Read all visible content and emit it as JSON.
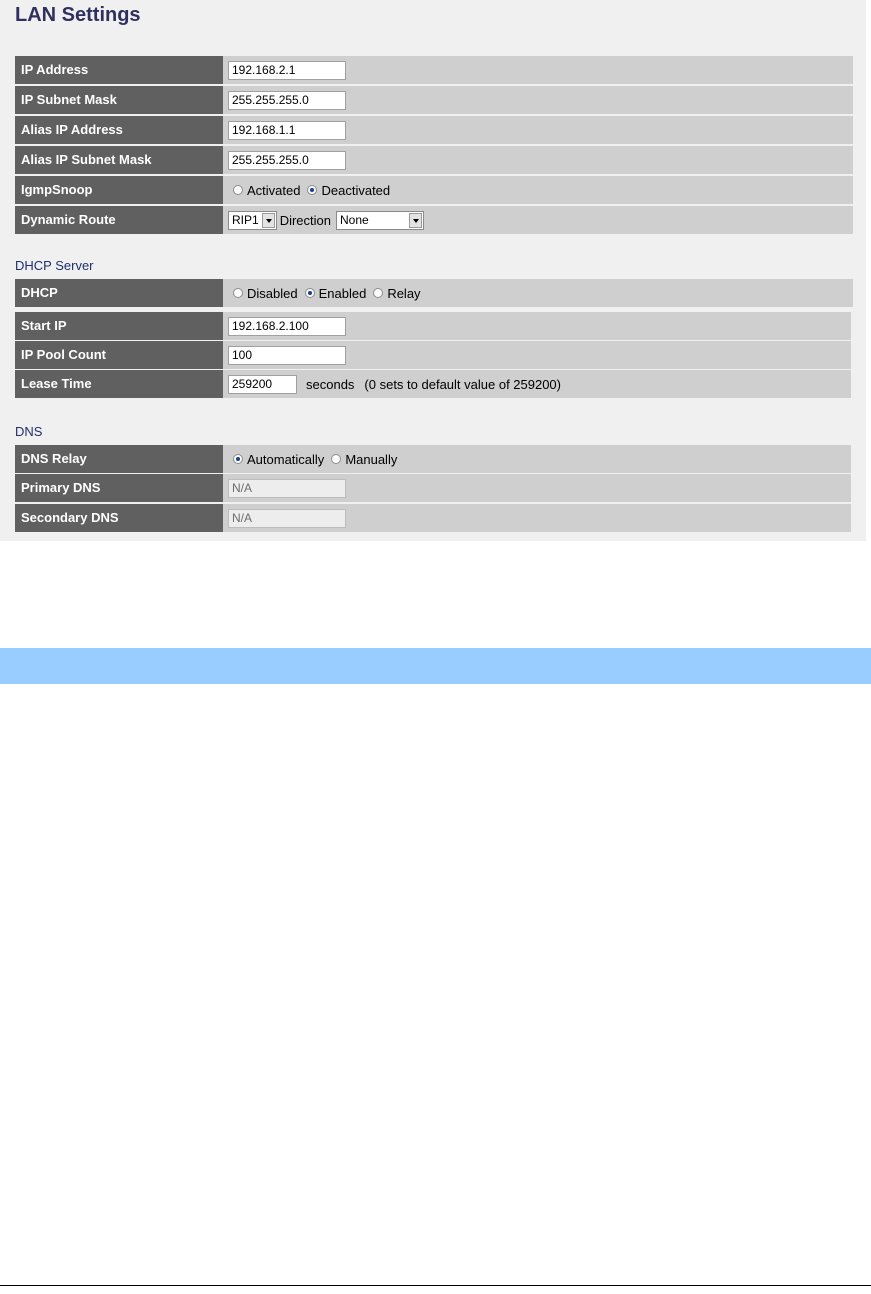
{
  "page_title": "LAN Settings",
  "lan": {
    "ip_address": {
      "label": "IP Address",
      "value": "192.168.2.1"
    },
    "subnet_mask": {
      "label": "IP Subnet Mask",
      "value": "255.255.255.0"
    },
    "alias_ip": {
      "label": "Alias IP Address",
      "value": "192.168.1.1"
    },
    "alias_mask": {
      "label": "Alias IP Subnet Mask",
      "value": "255.255.255.0"
    },
    "igmp": {
      "label": "IgmpSnoop",
      "options": [
        "Activated",
        "Deactivated"
      ],
      "selected": "Deactivated"
    },
    "dynamic_route": {
      "label": "Dynamic Route",
      "rip": "RIP1",
      "direction_label": "Direction",
      "direction": "None"
    }
  },
  "dhcp_section_title": "DHCP Server",
  "dhcp": {
    "mode": {
      "label": "DHCP",
      "options": [
        "Disabled",
        "Enabled",
        "Relay"
      ],
      "selected": "Enabled"
    },
    "start_ip": {
      "label": "Start IP",
      "value": "192.168.2.100"
    },
    "pool_count": {
      "label": "IP Pool Count",
      "value": "100"
    },
    "lease_time": {
      "label": "Lease Time",
      "value": "259200",
      "unit": "seconds",
      "note": "(0 sets to default value of 259200)"
    }
  },
  "dns_section_title": "DNS",
  "dns": {
    "relay": {
      "label": "DNS Relay",
      "options": [
        "Automatically",
        "Manually"
      ],
      "selected": "Automatically"
    },
    "primary": {
      "label": "Primary DNS",
      "value": "N/A"
    },
    "secondary": {
      "label": "Secondary DNS",
      "value": "N/A"
    }
  },
  "colors": {
    "label_bg": "#606060",
    "row_bg": "#cfcfcf",
    "title": "#303060",
    "banner": "#99ccff"
  }
}
